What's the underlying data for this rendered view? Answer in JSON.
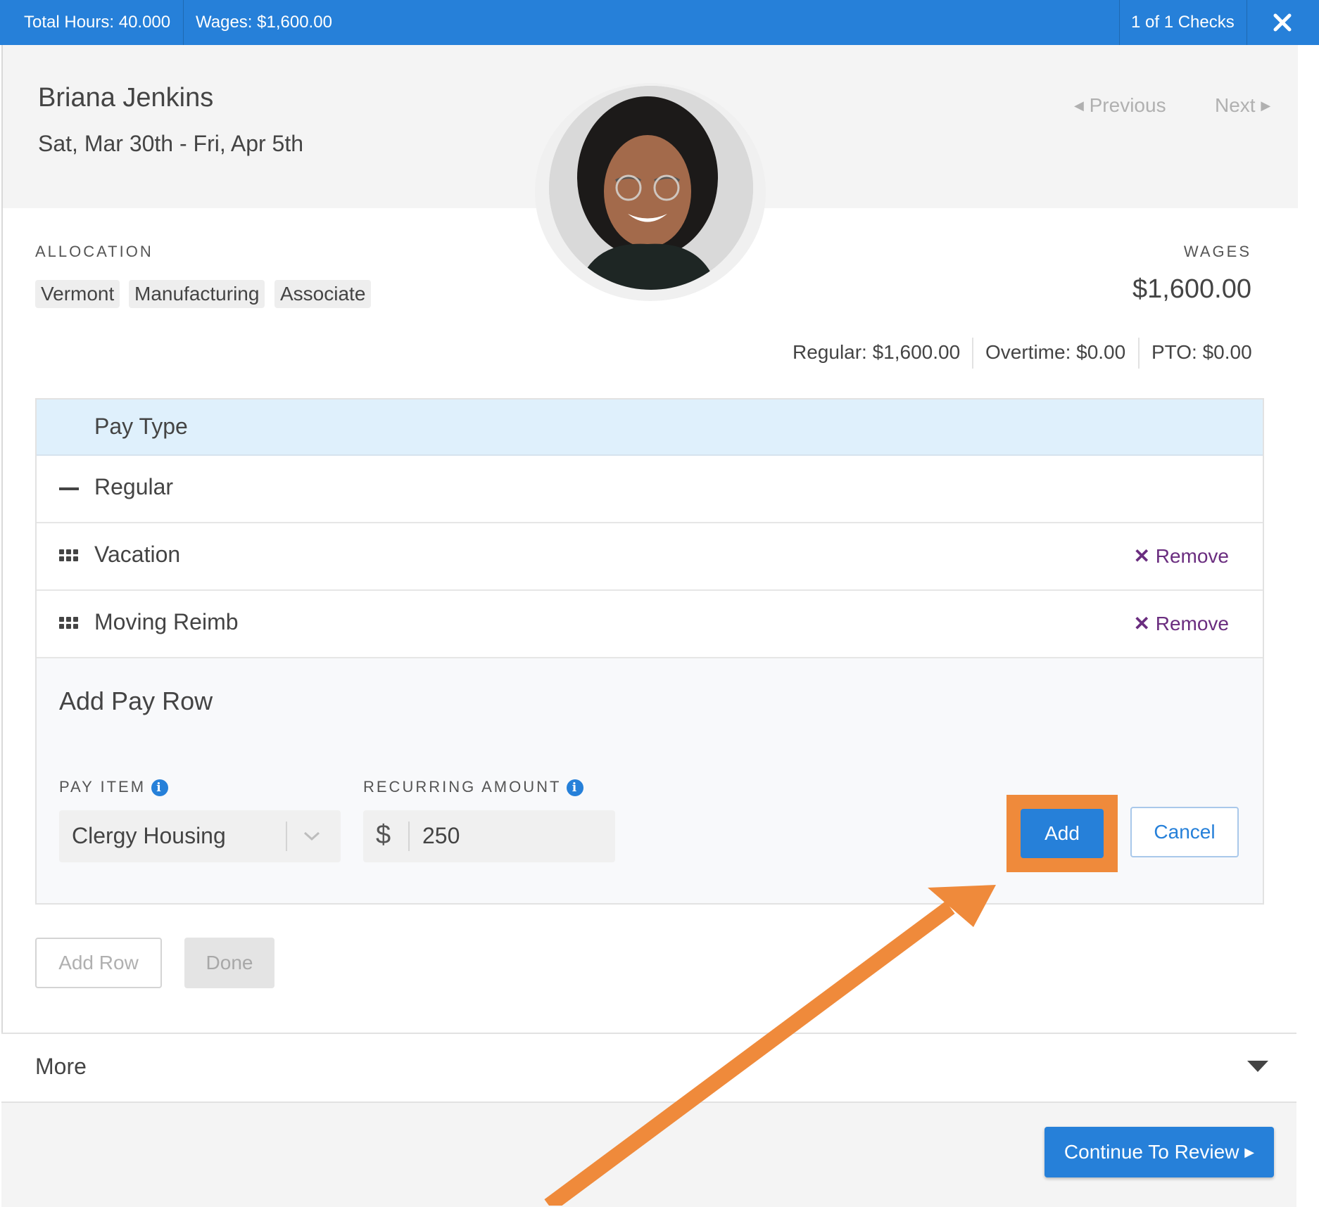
{
  "topbar": {
    "total_hours": "Total Hours: 40.000",
    "wages": "Wages: $1,600.00",
    "checks": "1 of 1 Checks",
    "close_icon": "close-icon",
    "color": "#2680d9"
  },
  "employee": {
    "name": "Briana Jenkins",
    "date_range": "Sat, Mar 30th - Fri, Apr 5th"
  },
  "nav": {
    "previous": "Previous",
    "next": "Next"
  },
  "allocation": {
    "label": "ALLOCATION",
    "tags": [
      "Vermont",
      "Manufacturing",
      "Associate"
    ]
  },
  "wages": {
    "label": "WAGES",
    "total": "$1,600.00",
    "regular": "Regular: $1,600.00",
    "overtime": "Overtime: $0.00",
    "pto": "PTO: $0.00"
  },
  "pay_table": {
    "header": "Pay Type",
    "rows": [
      {
        "label": "Regular"
      },
      {
        "label": "Vacation",
        "action": "Remove"
      },
      {
        "label": "Moving Reimb",
        "action": "Remove"
      }
    ]
  },
  "add_pay_row": {
    "title": "Add Pay Row",
    "pay_item_label": "PAY ITEM",
    "pay_item_value": "Clergy Housing",
    "recurring_label": "RECURRING AMOUNT",
    "currency_symbol": "$",
    "amount_value": "250",
    "add_label": "Add",
    "cancel_label": "Cancel",
    "highlight_color": "#ef8a3b"
  },
  "actions": {
    "add_row": "Add Row",
    "done": "Done"
  },
  "more": {
    "label": "More"
  },
  "footer": {
    "continue": "Continue To Review"
  }
}
